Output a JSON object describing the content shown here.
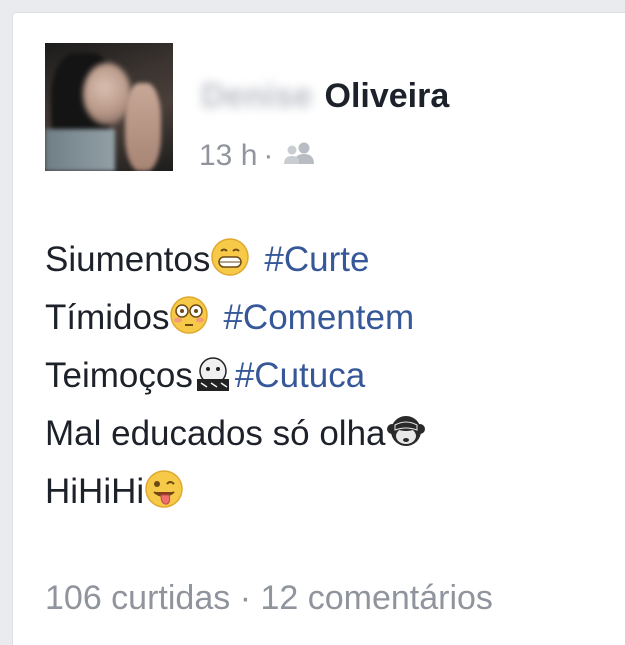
{
  "post": {
    "author_first_name": "Denise",
    "author_last_name": "Oliveira",
    "timestamp": "13 h",
    "separator": "·",
    "privacy_icon": "friends-icon",
    "lines": [
      {
        "text": "Siumentos",
        "emoji": "grinning-face-icon",
        "hashtag": "#Curte"
      },
      {
        "text": "Tímidos",
        "emoji": "flushed-face-icon",
        "hashtag": "#Comentem"
      },
      {
        "text": "Teimoços",
        "emoji": "hiding-face-icon",
        "hashtag": "#Cutuca"
      },
      {
        "text": "Mal educados só olha",
        "emoji": "see-no-evil-monkey-icon"
      },
      {
        "text": "HiHiHi",
        "emoji": "winking-tongue-face-icon"
      }
    ]
  },
  "footer": {
    "likes": "106 curtidas",
    "separator": "·",
    "comments": "12 comentários"
  },
  "colors": {
    "background": "#e9ebee",
    "card": "#ffffff",
    "text": "#1d2129",
    "hashtag": "#365899",
    "meta": "#90949c"
  }
}
